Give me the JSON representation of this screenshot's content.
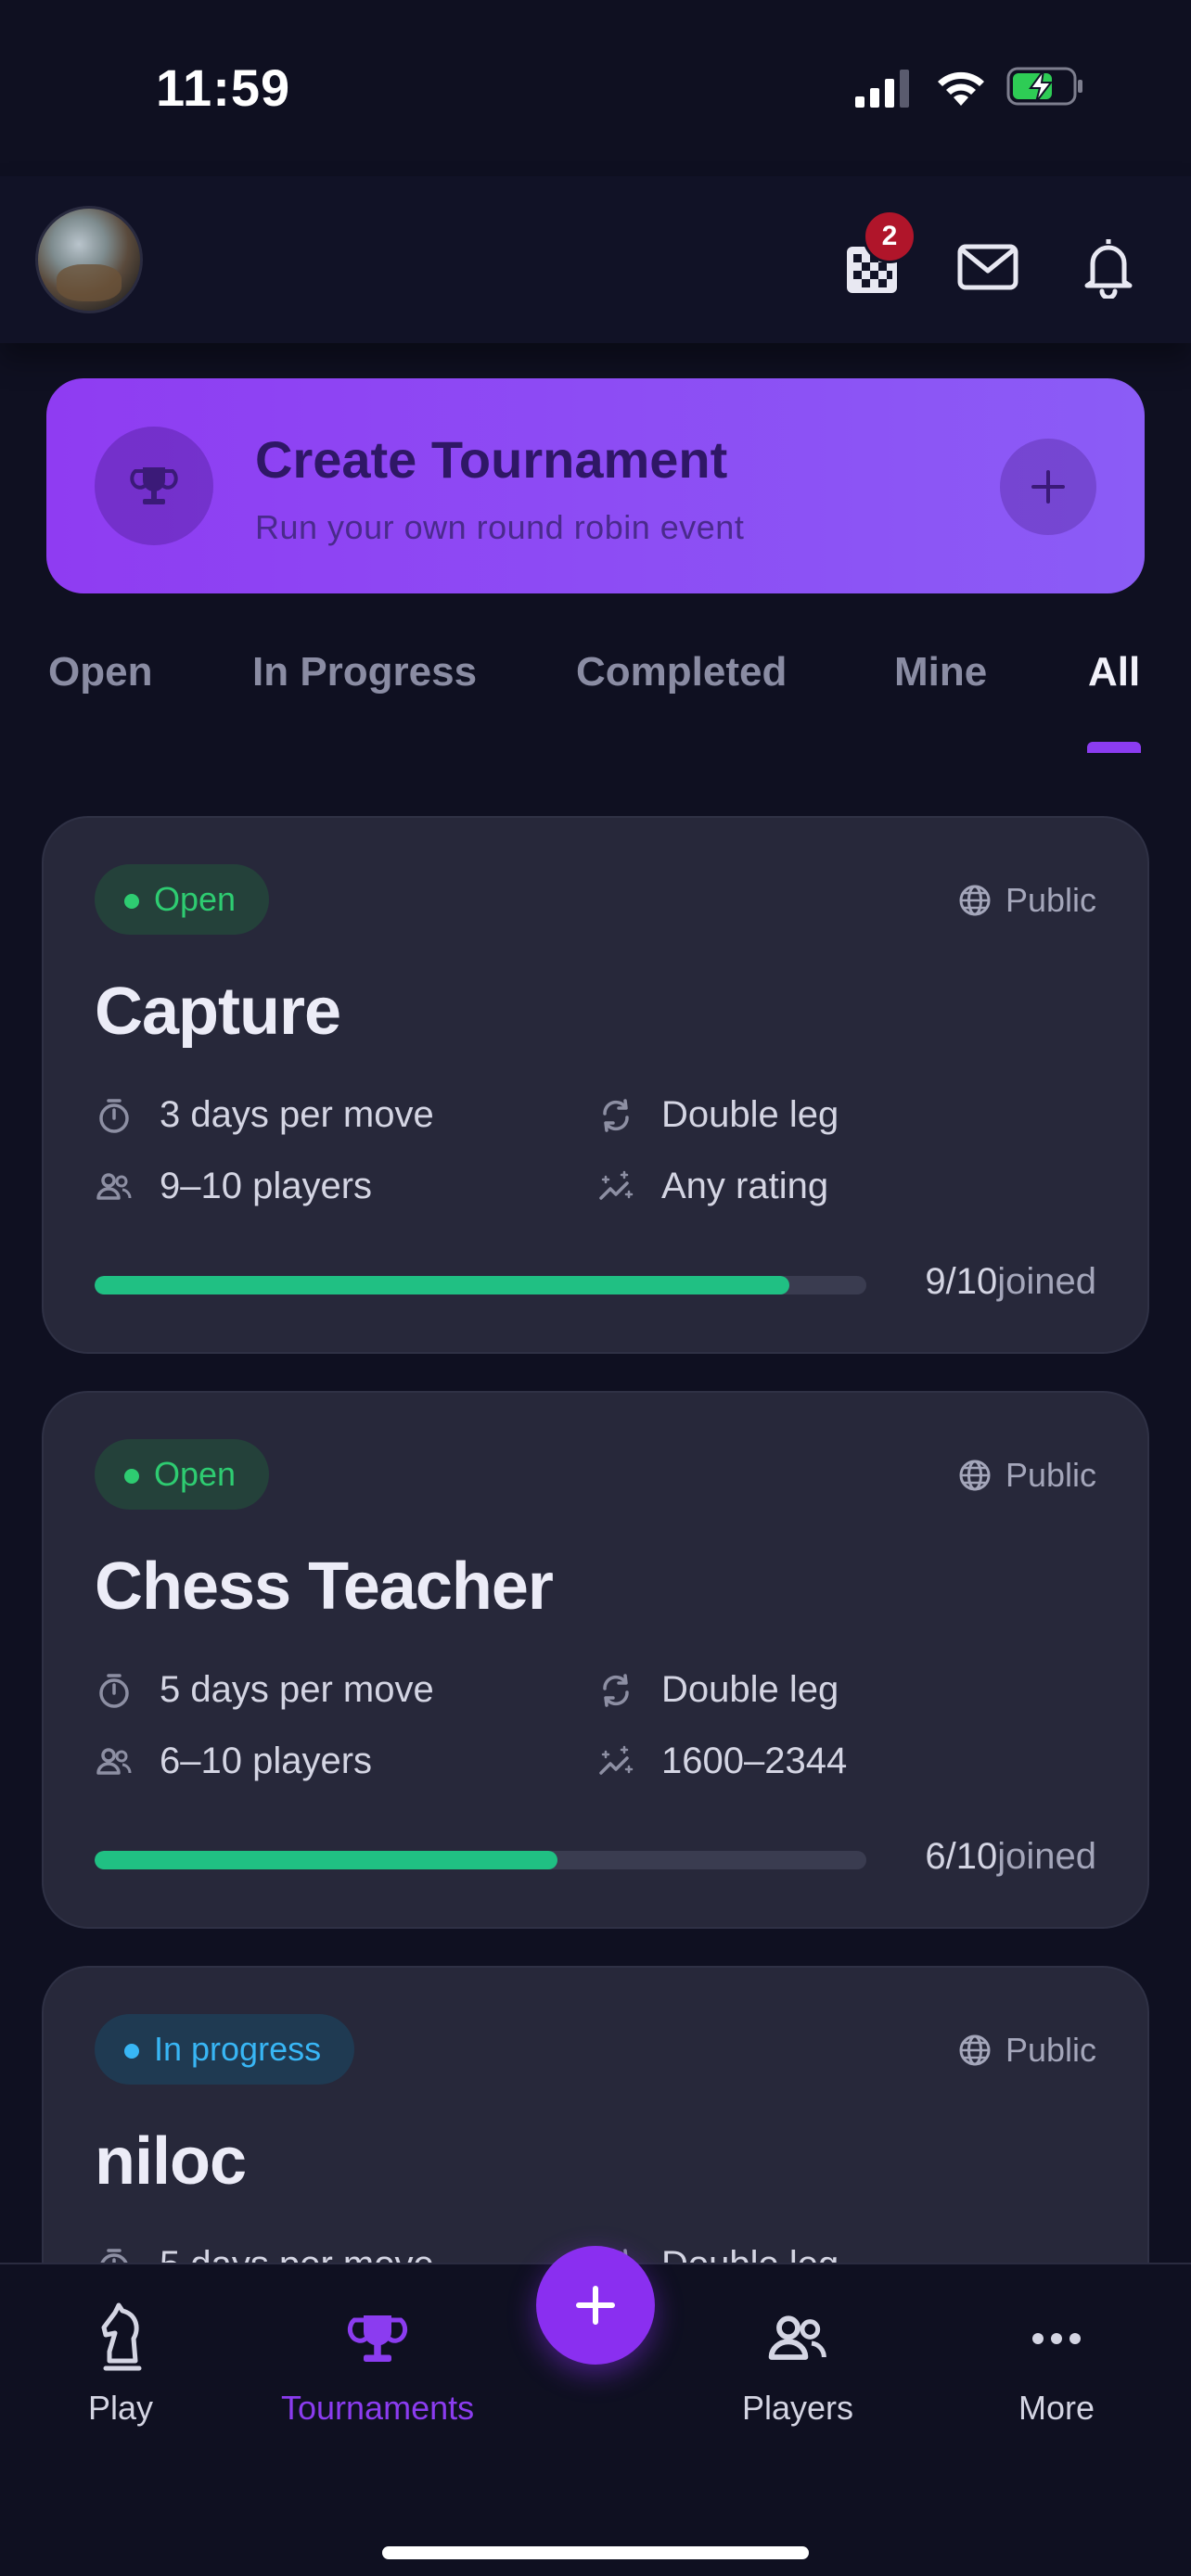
{
  "status_bar": {
    "time": "11:59"
  },
  "header": {
    "board_badge_count": "2"
  },
  "banner": {
    "title": "Create Tournament",
    "subtitle": "Run your own round robin event"
  },
  "tabs": [
    {
      "label": "Open"
    },
    {
      "label": "In Progress"
    },
    {
      "label": "Completed"
    },
    {
      "label": "Mine"
    },
    {
      "label": "All",
      "active": true
    }
  ],
  "cards": [
    {
      "status": "Open",
      "visibility": "Public",
      "title": "Capture",
      "time_control": "3 days per move",
      "format": "Double leg",
      "players": "9–10 players",
      "rating": "Any rating",
      "joined_count": "9/10",
      "joined_label": "joined",
      "joined_fraction": 0.9
    },
    {
      "status": "Open",
      "visibility": "Public",
      "title": "Chess Teacher",
      "time_control": "5 days per move",
      "format": "Double leg",
      "players": "6–10 players",
      "rating": "1600–2344",
      "joined_count": "6/10",
      "joined_label": "joined",
      "joined_fraction": 0.6
    },
    {
      "status": "In progress",
      "visibility": "Public",
      "title": "niloc",
      "time_control": "5 days per move",
      "format": "Double leg"
    }
  ],
  "bottom_nav": [
    {
      "label": "Play"
    },
    {
      "label": "Tournaments",
      "active": true
    },
    {
      "label": "Players"
    },
    {
      "label": "More"
    }
  ],
  "colors": {
    "accent": "#8b3cf0",
    "open_green": "#2ecc71",
    "progress_blue": "#38b6f5",
    "bar_green": "#20c083"
  }
}
